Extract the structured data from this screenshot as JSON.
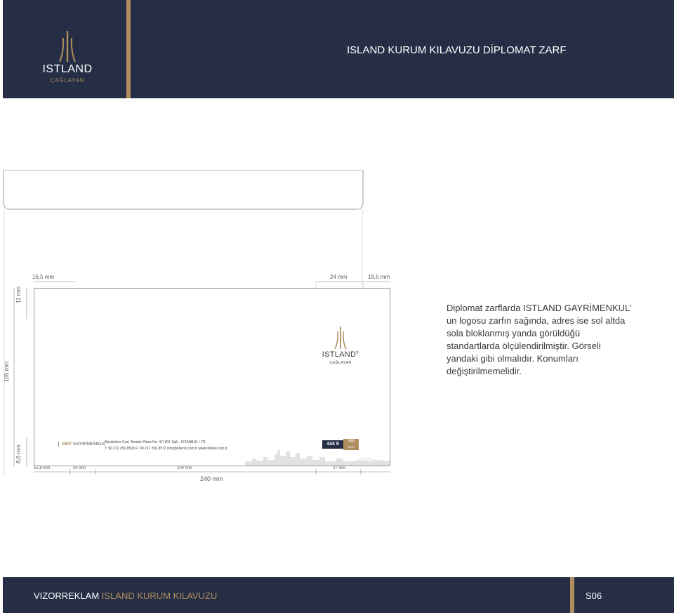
{
  "header": {
    "title": "ISLAND KURUM KILAVUZU DİPLOMAT ZARF",
    "logo_brand": "ISTLAND",
    "logo_sub": "ÇAĞLAYAN"
  },
  "dimensions": {
    "left_margin": "16,5 mm",
    "logo_width": "24 mm",
    "right_margin": "19,5 mm",
    "top_margin": "11 mm",
    "height": "105 mm",
    "bottom_strip": "8,6 mm",
    "bottom_left": "15,8 mm",
    "smy_width": "30 mm",
    "address_width": "104 mm",
    "badge_width": "27 mm",
    "total_width": "240 mm"
  },
  "envelope": {
    "logo_brand": "ISTLAND",
    "logo_registered": "®",
    "logo_sub": "ÇAĞLAYAN",
    "smy_bold": "SMY",
    "smy_rest": " GAYRİMENKUL",
    "address_line1": "Büyükdere Cad. Bentek Plaza No: 47/ 801 Şişli - İSTANBUL / TR",
    "address_line2": "T: 90 212 356 8500 F: 90 212 356 8572  info@istland.com.tr  www.istland.com.tr",
    "badge_main": "444 8",
    "badge_side_top": "769",
    "badge_side_bottom": "SMY"
  },
  "description": {
    "lines": [
      "Diplomat zarflarda ISTLAND GAYRİMENKUL'",
      "un logosu zarfın sağında, adres ise sol altda",
      "sola bloklanmış yanda görüldüğü",
      "standartlarda ölçülendirilmiştir. Görseli",
      "yandaki gibi olmalıdır. Konumları",
      "değiştirilmemelidir."
    ]
  },
  "footer": {
    "credit_white": "VIZORREKLAM",
    "credit_gold": " ISLAND KURUM KILAVUZU",
    "page": "S06"
  },
  "colors": {
    "navy": "#252e45",
    "gold": "#b08d5c"
  }
}
